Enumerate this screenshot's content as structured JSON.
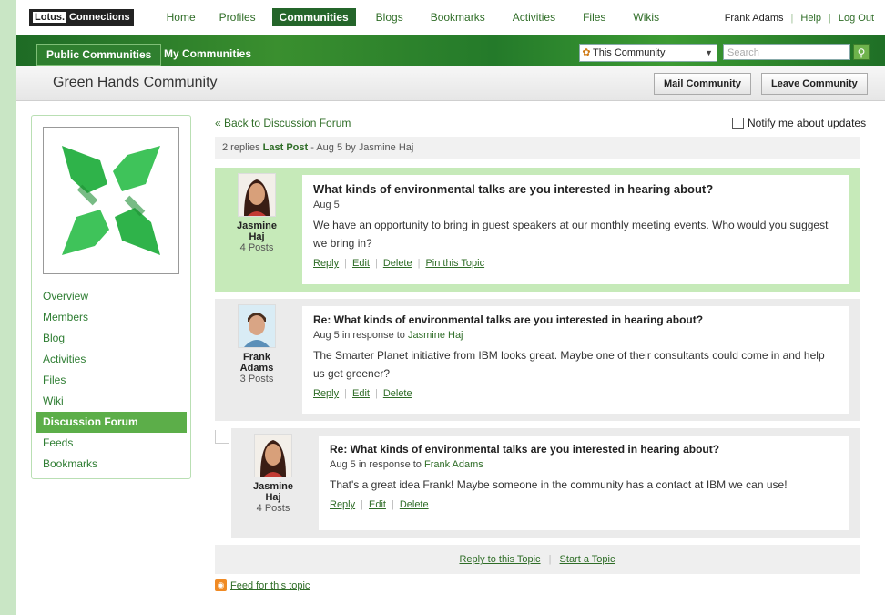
{
  "topnav": {
    "logo_brand": "Lotus.",
    "logo_product": "Connections",
    "items": [
      "Home",
      "Profiles",
      "Communities",
      "Blogs",
      "Bookmarks",
      "Activities",
      "Files",
      "Wikis"
    ],
    "active": "Communities",
    "user": "Frank Adams",
    "help": "Help",
    "logout": "Log Out"
  },
  "banner": {
    "tabs": [
      "Public Communities",
      "My Communities"
    ],
    "scope_label": "This Community",
    "search_placeholder": "Search",
    "scope_icon": "community-icon",
    "search_icon": "magnifier-icon"
  },
  "community": {
    "title": "Green Hands Community",
    "mail_button": "Mail Community",
    "leave_button": "Leave Community"
  },
  "sidebar": {
    "items": [
      "Overview",
      "Members",
      "Blog",
      "Activities",
      "Files",
      "Wiki",
      "Discussion Forum",
      "Feeds",
      "Bookmarks"
    ],
    "active": "Discussion Forum"
  },
  "topic": {
    "back_link": "« Back to Discussion Forum",
    "notify_label": "Notify me about updates",
    "replies": "2 replies",
    "last_post_label": "Last Post",
    "last_post_info": "- Aug 5 by Jasmine Haj"
  },
  "posts": [
    {
      "author": "Jasmine Haj",
      "posts": "4 Posts",
      "title": "What kinds of environmental talks are you interested in hearing about?",
      "date": "Aug 5",
      "in_response_to": "",
      "body": "We have an opportunity to bring in guest speakers at our monthly meeting events. Who would you suggest we bring in?",
      "actions": [
        "Reply",
        "Edit",
        "Delete",
        "Pin this Topic"
      ]
    },
    {
      "author": "Frank Adams",
      "posts": "3 Posts",
      "title": "Re: What kinds of environmental talks are you interested in hearing about?",
      "date": "Aug 5",
      "response_prefix": "in response to",
      "in_response_to": "Jasmine Haj",
      "body": "The Smarter Planet initiative from IBM looks great. Maybe one of their consultants could come in and help us get greener?",
      "actions": [
        "Reply",
        "Edit",
        "Delete"
      ]
    },
    {
      "author": "Jasmine Haj",
      "posts": "4 Posts",
      "title": "Re: What kinds of environmental talks are you interested in hearing about?",
      "date": "Aug 5",
      "response_prefix": "in response to",
      "in_response_to": "Frank Adams",
      "body": "That's a great idea Frank! Maybe someone in the community has a contact at IBM we can use!",
      "actions": [
        "Reply",
        "Edit",
        "Delete"
      ]
    }
  ],
  "footer": {
    "reply_to_topic": "Reply to this Topic",
    "start_topic": "Start a Topic",
    "feed_label": "Feed for this topic"
  },
  "colors": {
    "brand_green": "#24652a",
    "link_green": "#2f6d27",
    "highlight_green": "#c6eab9",
    "page_background": "#c9e6c5"
  }
}
